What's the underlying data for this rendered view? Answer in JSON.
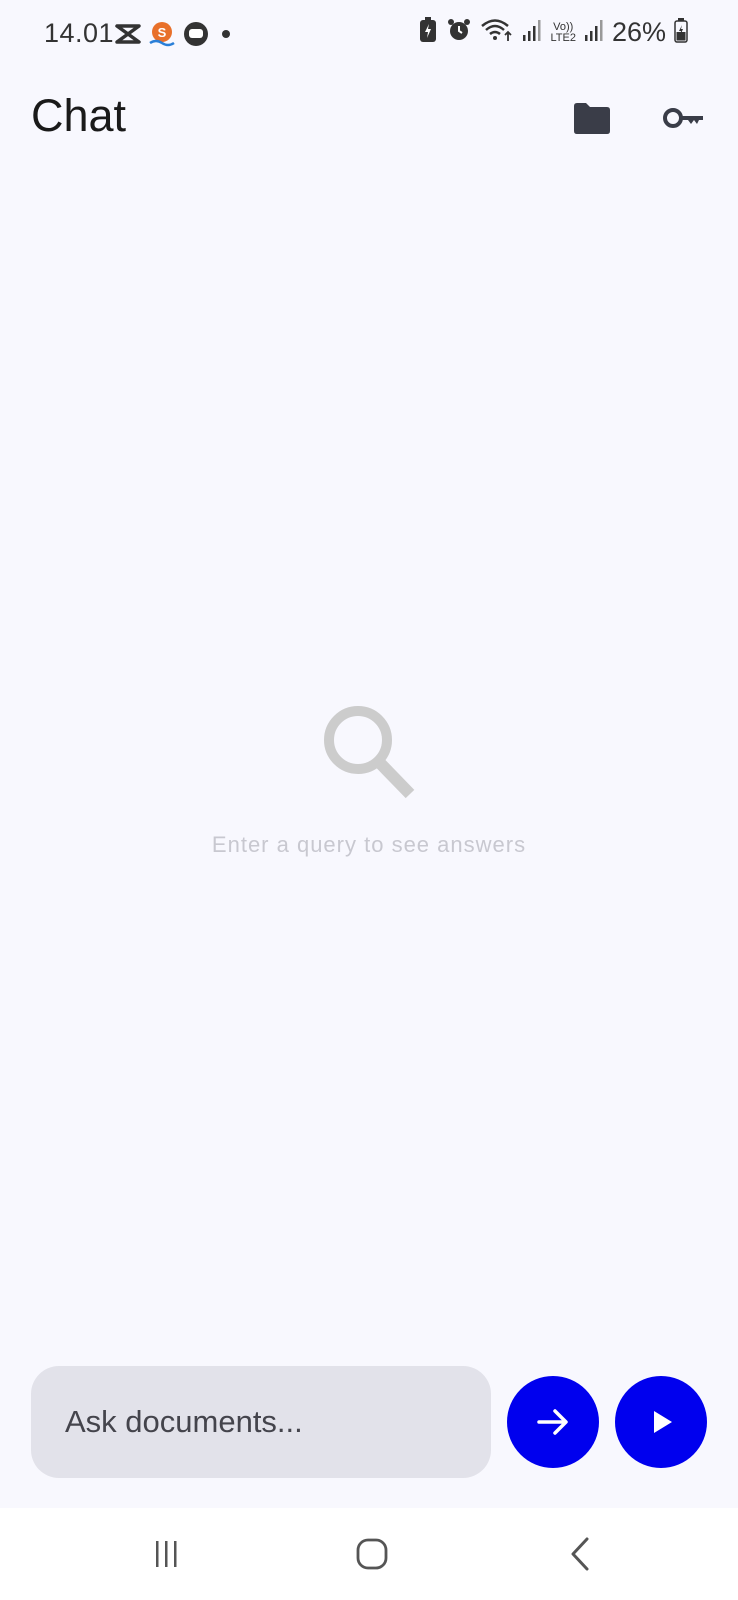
{
  "status_bar": {
    "time": "14.01",
    "network_label_top": "Vo))",
    "network_label_bottom": "LTE2",
    "battery_percent": "26%",
    "icons": [
      "capcut-icon",
      "shopee-icon",
      "chat-bubble-icon",
      "dot-icon",
      "battery-saver-icon",
      "alarm-icon",
      "wifi-icon",
      "signal-icon",
      "signal-icon",
      "battery-icon"
    ]
  },
  "app_bar": {
    "title": "Chat",
    "actions": [
      "folder-icon",
      "key-icon"
    ]
  },
  "empty_state": {
    "icon": "search-icon",
    "message": "Enter a query to see answers"
  },
  "input": {
    "placeholder": "Ask documents...",
    "value": ""
  },
  "buttons": {
    "send_icon": "arrow-right-icon",
    "play_icon": "play-icon"
  },
  "navigation": {
    "items": [
      "recents-icon",
      "home-icon",
      "back-icon"
    ]
  },
  "colors": {
    "accent": "#0000ee",
    "background": "#f8f8fe",
    "input_background": "#e2e2ea",
    "empty_text": "#c8c8d0",
    "icon_dark": "#3a3d48"
  }
}
